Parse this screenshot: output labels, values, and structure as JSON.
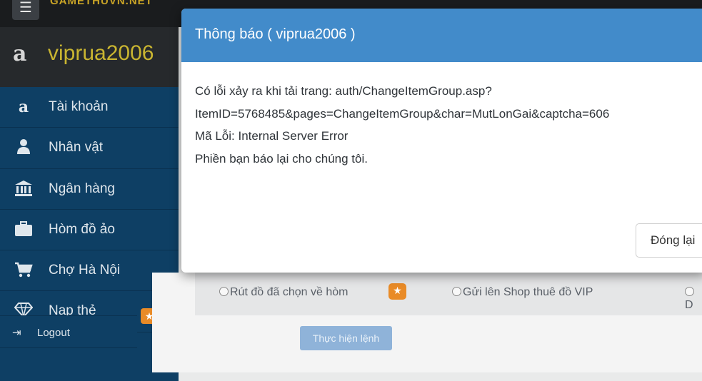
{
  "topbar": {
    "menu_icon": "hamburger-icon",
    "logo_text": "GAMETHUVN.NET"
  },
  "sidebar": {
    "user_icon": "amazon-icon",
    "username": "viprua2006",
    "items": [
      {
        "icon": "amazon-icon",
        "label": "Tài khoản"
      },
      {
        "icon": "user-icon",
        "label": "Nhân vật"
      },
      {
        "icon": "bank-icon",
        "label": "Ngân hàng"
      },
      {
        "icon": "briefcase-icon",
        "label": "Hòm đồ ảo"
      },
      {
        "icon": "cart-icon",
        "label": "Chợ Hà Nội"
      },
      {
        "icon": "diamond-icon",
        "label": "Nạp thẻ",
        "badge_icon": "star-icon"
      }
    ],
    "logout": {
      "icon": "sign-out-icon",
      "label": "Logout"
    }
  },
  "main": {
    "options": [
      {
        "label": "Rút đồ đã chọn về hòm"
      },
      {
        "label": "Gửi lên Shop thuê đồ VIP"
      },
      {
        "label": "D"
      }
    ],
    "option_badge_icon": "star-icon",
    "execute_label": "Thực hiện lệnh"
  },
  "modal": {
    "title": "Thông báo ( viprua2006 )",
    "lines": [
      "Có lỗi xảy ra khi tải trang: auth/ChangeItemGroup.asp?",
      "ItemID=5768485&pages=ChangeItemGroup&char=MutLonGai&captcha=606",
      "Mã Lỗi: Internal Server Error",
      "Phiền bạn báo lại cho chúng tôi."
    ],
    "close_label": "Đóng lại"
  },
  "colors": {
    "sidebar_bg": "#0e3f64",
    "header_bg": "#26292c",
    "username": "#c9b531",
    "modal_header": "#428bca",
    "badge": "#e98b27",
    "execute_button": "#8fb3d9"
  }
}
